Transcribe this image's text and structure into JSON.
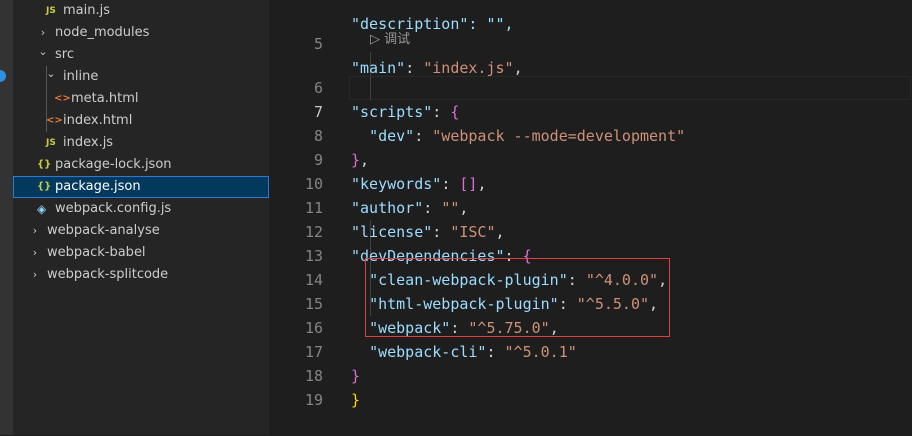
{
  "explorer": {
    "items": [
      {
        "label": "main.js",
        "icon": "JS",
        "icon_name": "js-file-icon"
      },
      {
        "label": "node_modules",
        "icon": "›",
        "icon_name": "chevron-right-icon"
      },
      {
        "label": "src",
        "icon": "⌄",
        "icon_name": "chevron-down-icon"
      },
      {
        "label": "inline",
        "icon": "⌄",
        "icon_name": "chevron-down-icon"
      },
      {
        "label": "meta.html",
        "icon": "<>",
        "icon_name": "html-file-icon"
      },
      {
        "label": "index.html",
        "icon": "<>",
        "icon_name": "html-file-icon"
      },
      {
        "label": "index.js",
        "icon": "JS",
        "icon_name": "js-file-icon"
      },
      {
        "label": "package-lock.json",
        "icon": "{}",
        "icon_name": "json-file-icon"
      },
      {
        "label": "package.json",
        "icon": "{}",
        "icon_name": "json-file-icon",
        "selected": true
      },
      {
        "label": "webpack.config.js",
        "icon": "◈",
        "icon_name": "webpack-file-icon"
      },
      {
        "label": "webpack-analyse",
        "icon": "›",
        "icon_name": "chevron-right-icon"
      },
      {
        "label": "webpack-babel",
        "icon": "›",
        "icon_name": "chevron-right-icon"
      },
      {
        "label": "webpack-splitcode",
        "icon": "›",
        "icon_name": "chevron-right-icon"
      }
    ]
  },
  "editor": {
    "codelens": "▷ 调试",
    "lines": {
      "l4": {
        "num": "",
        "c1": "\"description\": \"\","
      },
      "l5": {
        "num": "5",
        "k": "\"main\"",
        "p": ": ",
        "s": "\"index.js\"",
        "e": ","
      },
      "l6": {
        "num": "6",
        "k": "\"scripts\"",
        "p": ": ",
        "b": "{"
      },
      "l7": {
        "num": "7",
        "k": "\"dev\"",
        "p": ": ",
        "s": "\"webpack --mode=development\""
      },
      "l8": {
        "num": "8",
        "b": "}",
        "e": ","
      },
      "l9": {
        "num": "9",
        "k": "\"keywords\"",
        "p": ": ",
        "b": "[]",
        "e": ","
      },
      "l10": {
        "num": "10",
        "k": "\"author\"",
        "p": ": ",
        "s": "\"\"",
        "e": ","
      },
      "l11": {
        "num": "11",
        "k": "\"license\"",
        "p": ": ",
        "s": "\"ISC\"",
        "e": ","
      },
      "l12": {
        "num": "12",
        "k": "\"devDependencies\"",
        "p": ": ",
        "b": "{"
      },
      "l13": {
        "num": "13",
        "k": "\"clean-webpack-plugin\"",
        "p": ": ",
        "s": "\"^4.0.0\"",
        "e": ","
      },
      "l14": {
        "num": "14",
        "k": "\"html-webpack-plugin\"",
        "p": ": ",
        "s": "\"^5.5.0\"",
        "e": ","
      },
      "l15": {
        "num": "15",
        "k": "\"webpack\"",
        "p": ": ",
        "s": "\"^5.75.0\"",
        "e": ","
      },
      "l16": {
        "num": "16",
        "k": "\"webpack-cli\"",
        "p": ": ",
        "s": "\"^5.0.1\""
      },
      "l17": {
        "num": "17",
        "b": "}"
      },
      "l18": {
        "num": "18",
        "b": "}"
      },
      "l19": {
        "num": "19"
      }
    }
  },
  "colors": {
    "key": "#9cdcfe",
    "string": "#ce9178",
    "bracket_level1": "#da70d6",
    "bracket_level2": "#ffd700",
    "selection": "#04395e",
    "highlight_box": "#e04040"
  }
}
